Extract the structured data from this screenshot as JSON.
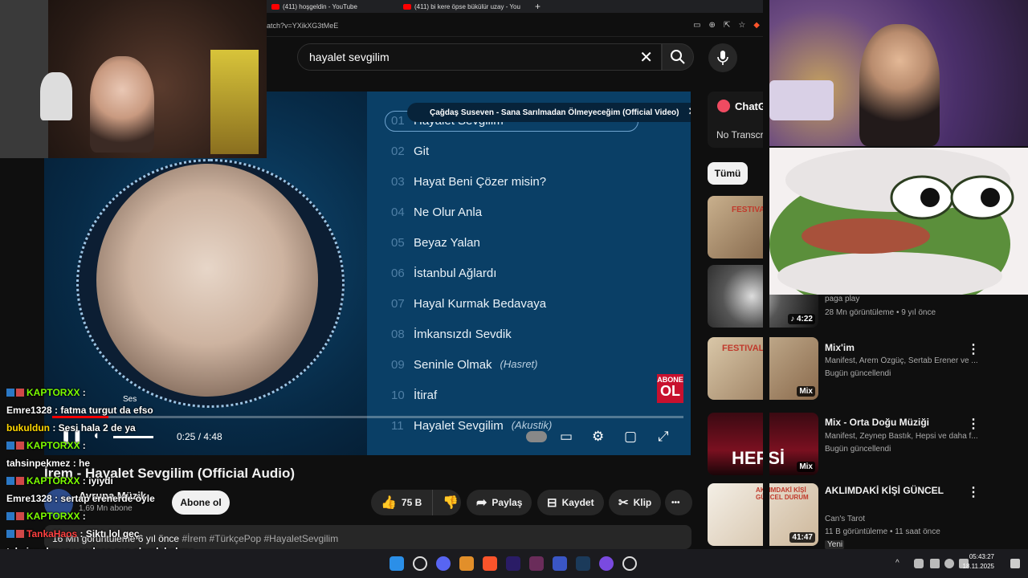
{
  "browser": {
    "tabs": [
      {
        "label": "(411) hoşgeldin - YouTube"
      },
      {
        "label": "(411) bi kere öpse bükülür uzay - You"
      }
    ],
    "new_tab": "+",
    "url": "atch?v=YXikXG3tMeE"
  },
  "search": {
    "query": "hayalet sevgilim",
    "clear_icon": "✕",
    "search_icon": "search-icon",
    "mic_icon": "mic-icon"
  },
  "video": {
    "notification": "Çağdaş Suseven - Sana Sarılmadan Ölmeyeceğim (Official Video)",
    "tracklist": [
      {
        "num": "01",
        "title": "Hayalet Sevgilim",
        "note": ""
      },
      {
        "num": "02",
        "title": "Git",
        "note": ""
      },
      {
        "num": "03",
        "title": "Hayat Beni Çözer misin?",
        "note": ""
      },
      {
        "num": "04",
        "title": "Ne Olur Anla",
        "note": ""
      },
      {
        "num": "05",
        "title": "Beyaz Yalan",
        "note": ""
      },
      {
        "num": "06",
        "title": "İstanbul Ağlardı",
        "note": ""
      },
      {
        "num": "07",
        "title": "Hayal Kurmak Bedavaya",
        "note": ""
      },
      {
        "num": "08",
        "title": "İmkansızdı Sevdik",
        "note": ""
      },
      {
        "num": "09",
        "title": "Seninle Olmak",
        "note": "(Hasret)"
      },
      {
        "num": "10",
        "title": "İtiraf",
        "note": ""
      },
      {
        "num": "11",
        "title": "Hayalet Sevgilim",
        "note": "(Akustik)"
      }
    ],
    "abone_line1": "ABONE",
    "abone_line2": "OL",
    "time": "0:25 / 4:48",
    "volume_tooltip": "Ses",
    "progress_fraction": 0.089
  },
  "details": {
    "title": "İrem - Hayalet Sevgilim (Official Audio)",
    "channel": "Avrupa Müzik",
    "subscribers": "1,69 Mn abone",
    "subscribe_label": "Abone ol",
    "likes": "75 B",
    "share_label": "Paylaş",
    "save_label": "Kaydet",
    "clip_label": "Klip",
    "more_label": "•••",
    "views_date": "16 Mn görüntüleme  6 yıl önce",
    "hashtags": "#İrem #TürkçePop #HayaletSevgilim"
  },
  "sidebar": {
    "chatgpt_title": "ChatG",
    "no_transcript": "No Transcri",
    "chip_all": "Tümü",
    "items": [
      {
        "title": "paga play",
        "meta1": "28 Mn görüntüleme • 9 yıl önce",
        "meta2": "",
        "badge": "♪ 4:22"
      },
      {
        "title": "Mix'im",
        "meta1": "Manifest, Arem Özgüç, Sertab Erener ve ...",
        "meta2": "Bugün güncellendi",
        "badge": "Mix"
      },
      {
        "title": "Mix - Orta Doğu Müziği",
        "meta1": "Manifest, Zeynep Bastık, Hepsi ve daha f...",
        "meta2": "Bugün güncellendi",
        "badge": "Mix"
      },
      {
        "title": "AKLIMDAKİ KİŞİ GÜNCEL",
        "meta1": "Can's Tarot",
        "meta2": "11 B görüntüleme • 11 saat önce",
        "badge": "41:47",
        "new": "Yeni"
      }
    ],
    "thumb_texts": [
      "FESTIVAL",
      "HEPSİ",
      "AKLIMDAKİ KİŞİ GÜNCEL DURUM"
    ]
  },
  "chat": [
    {
      "user": "KAPTORXX",
      "msg": "",
      "color": "#7cfc00"
    },
    {
      "user": "Emre1328",
      "msg": "fatma turgut da efso",
      "color": "#ffffff"
    },
    {
      "user": "bukuldun",
      "msg": "Sesi hala 2 de ya",
      "color": "#ffd700"
    },
    {
      "user": "KAPTORXX",
      "msg": "",
      "color": "#7cfc00"
    },
    {
      "user": "tahsinpekmez",
      "msg": "he",
      "color": "#ffffff"
    },
    {
      "user": "KAPTORXX",
      "msg": "iyiydi",
      "color": "#7cfc00"
    },
    {
      "user": "Emre1328",
      "msg": "sertap erenerde öyle",
      "color": "#ffffff"
    },
    {
      "user": "KAPTORXX",
      "msg": "",
      "color": "#7cfc00"
    },
    {
      "user": "TankaHaos",
      "msg": "Siktı lol geç",
      "color": "#ff4040"
    },
    {
      "user": "tahsinpekmez",
      "msg": "sadece ses olarak bakma",
      "color": "#ffffff"
    }
  ],
  "taskbar": {
    "time": "05:43:27",
    "date": "18.11.2025"
  }
}
